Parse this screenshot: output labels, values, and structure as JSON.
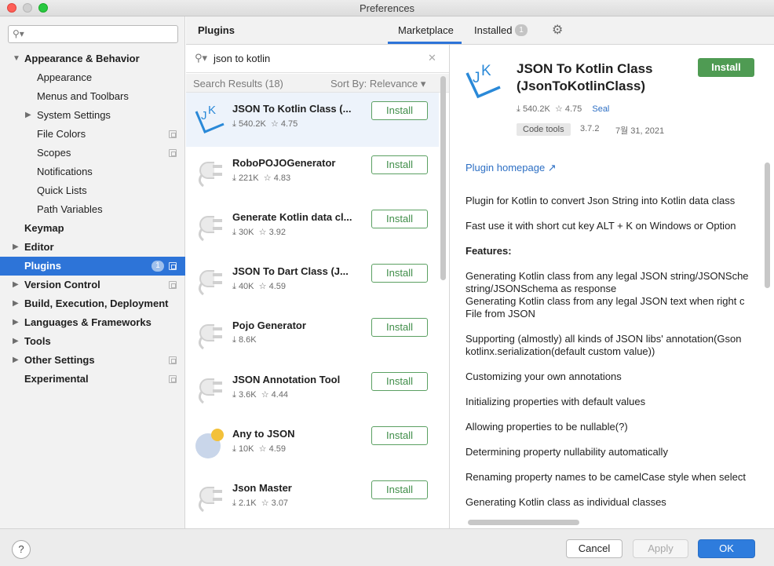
{
  "window": {
    "title": "Preferences"
  },
  "sidebar": {
    "search": {
      "placeholder": ""
    },
    "items": [
      {
        "label": "Appearance & Behavior",
        "bold": true,
        "expanded": true
      },
      {
        "label": "Appearance"
      },
      {
        "label": "Menus and Toolbars"
      },
      {
        "label": "System Settings",
        "expandable": true
      },
      {
        "label": "File Colors"
      },
      {
        "label": "Scopes"
      },
      {
        "label": "Notifications"
      },
      {
        "label": "Quick Lists"
      },
      {
        "label": "Path Variables"
      },
      {
        "label": "Keymap",
        "bold": true
      },
      {
        "label": "Editor",
        "bold": true,
        "expandable": true
      },
      {
        "label": "Plugins",
        "bold": true,
        "selected": true,
        "badge": "1"
      },
      {
        "label": "Version Control",
        "bold": true,
        "expandable": true
      },
      {
        "label": "Build, Execution, Deployment",
        "bold": true,
        "expandable": true
      },
      {
        "label": "Languages & Frameworks",
        "bold": true,
        "expandable": true
      },
      {
        "label": "Tools",
        "bold": true,
        "expandable": true
      },
      {
        "label": "Other Settings",
        "bold": true,
        "expandable": true
      },
      {
        "label": "Experimental",
        "bold": true
      }
    ]
  },
  "header": {
    "title": "Plugins",
    "tabs": [
      {
        "label": "Marketplace",
        "active": true
      },
      {
        "label": "Installed",
        "badge": "1"
      }
    ]
  },
  "search": {
    "value": "json to kotlin"
  },
  "results": {
    "count_label": "Search Results (18)",
    "sort_label": "Sort By: Relevance ▾"
  },
  "plugins": [
    {
      "name": "JSON To Kotlin Class (...",
      "downloads": "540.2K",
      "rating": "4.75",
      "button": "Install",
      "selected": true
    },
    {
      "name": "RoboPOJOGenerator",
      "downloads": "221K",
      "rating": "4.83",
      "button": "Install"
    },
    {
      "name": "Generate Kotlin data cl...",
      "downloads": "30K",
      "rating": "3.92",
      "button": "Install"
    },
    {
      "name": "JSON To Dart Class (J...",
      "downloads": "40K",
      "rating": "4.59",
      "button": "Install"
    },
    {
      "name": "Pojo Generator",
      "downloads": "8.6K",
      "rating": "",
      "button": "Install"
    },
    {
      "name": "JSON Annotation Tool",
      "downloads": "3.6K",
      "rating": "4.44",
      "button": "Install"
    },
    {
      "name": "Any to JSON",
      "downloads": "10K",
      "rating": "4.59",
      "button": "Install"
    },
    {
      "name": "Json Master",
      "downloads": "2.1K",
      "rating": "3.07",
      "button": "Install"
    }
  ],
  "detail": {
    "title_line1": "JSON To Kotlin Class",
    "title_line2": "(JsonToKotlinClass)",
    "install_label": "Install",
    "downloads": "540.2K",
    "rating": "4.75",
    "vendor": "Seal",
    "tag": "Code tools",
    "version": "3.7.2",
    "date": "7월 31, 2021",
    "homepage": "Plugin homepage ↗",
    "lines": [
      "Plugin for Kotlin to convert Json String into Kotlin data class",
      "Fast use it with short cut key ALT + K on Windows or Option",
      "Features:",
      "Generating Kotlin class from any legal JSON string/JSONSche",
      "string/JSONSchema as response",
      "Generating Kotlin class from any legal JSON text when right c",
      "File from JSON",
      "Supporting (almostly) all kinds of JSON libs' annotation(Gson",
      "kotlinx.serialization(default custom value))",
      "Customizing your own annotations",
      "Initializing properties with default values",
      "Allowing properties to be nullable(?)",
      "Determining property nullability automatically",
      "Renaming property names to be camelCase style when select",
      "Generating Kotlin class as individual classes"
    ]
  },
  "footer": {
    "help": "?",
    "cancel": "Cancel",
    "apply": "Apply",
    "ok": "OK"
  },
  "colors": {
    "accent": "#2d74d8",
    "install_green": "#4f9b53",
    "seal_blue": "#2d6fc4"
  },
  "icons": [
    "search-icon",
    "clear-icon",
    "gear-icon",
    "download-icon",
    "star-icon",
    "plug-icon",
    "jk-logo-icon",
    "copy-icon",
    "chevron-right-icon",
    "chevron-down-icon",
    "help-icon"
  ]
}
